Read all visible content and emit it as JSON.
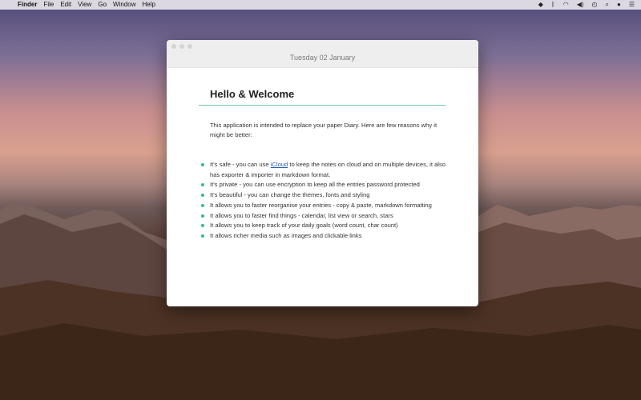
{
  "menubar": {
    "app_name": "Finder",
    "items": [
      "File",
      "Edit",
      "View",
      "Go",
      "Window",
      "Help"
    ]
  },
  "status_icons": [
    "dropbox-icon",
    "bluetooth-icon",
    "wifi-icon",
    "volume-icon",
    "time-machine-icon",
    "search-icon",
    "siri-icon",
    "notification-center-icon"
  ],
  "window": {
    "date": "Tuesday 02 January",
    "heading": "Hello & Welcome",
    "intro": "This application is intended to replace your paper Diary. Here are few reasons why it might be better:",
    "features": [
      {
        "text_before": "It's safe - you can use ",
        "link": "iCloud",
        "text_after": " to keep the notes on cloud and on multiple devices, it also has exporter & importer in markdown format."
      },
      {
        "text": "It's private - you can use encryption to keep all the entries password protected"
      },
      {
        "text": "It's beautiful - you can change the themes, fonts  and styling"
      },
      {
        "text": "It allows you to faster reorganise your entries - copy & paste, markdown formatting"
      },
      {
        "text": "It allows you to faster find things - calendar, list view or search, stars"
      },
      {
        "text": "It allows you to keep track of your daily goals (word count, char count)"
      },
      {
        "text": "It allows richer media such as images and clickable links"
      }
    ]
  },
  "colors": {
    "accent": "#39b98a",
    "heading_rule": "#6cc7a6"
  }
}
